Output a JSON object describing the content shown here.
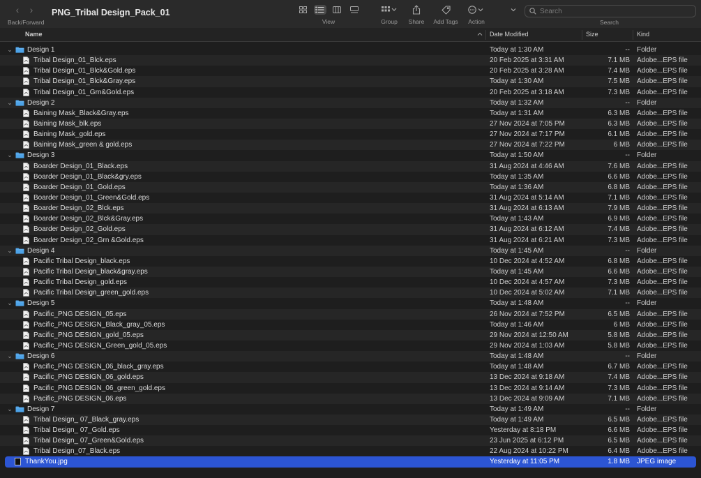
{
  "toolbar": {
    "title": "PNG_Tribal Design_Pack_01",
    "back_forward_label": "Back/Forward",
    "view_label": "View",
    "group_label": "Group",
    "share_label": "Share",
    "add_tags_label": "Add Tags",
    "action_label": "Action",
    "search_placeholder": "Search",
    "search_label": "Search"
  },
  "columns": {
    "name": "Name",
    "date": "Date Modified",
    "size": "Size",
    "kind": "Kind"
  },
  "rows": [
    {
      "type": "folder",
      "name": "Design 1",
      "date": "Today at 1:30 AM",
      "size": "--",
      "kind": "Folder"
    },
    {
      "type": "file",
      "name": "Tribal Design_01_Blck.eps",
      "date": "20 Feb 2025 at 3:31 AM",
      "size": "7.1 MB",
      "kind": "Adobe...EPS file"
    },
    {
      "type": "file",
      "name": "Tribal Design_01_Blck&Gold.eps",
      "date": "20 Feb 2025 at 3:28 AM",
      "size": "7.4 MB",
      "kind": "Adobe...EPS file"
    },
    {
      "type": "file",
      "name": "Tribal Design_01_Blck&Gray.eps",
      "date": "Today at 1:30 AM",
      "size": "7.5 MB",
      "kind": "Adobe...EPS file"
    },
    {
      "type": "file",
      "name": "Tribal Design_01_Grn&Gold.eps",
      "date": "20 Feb 2025 at 3:18 AM",
      "size": "7.3 MB",
      "kind": "Adobe...EPS file"
    },
    {
      "type": "folder",
      "name": "Design 2",
      "date": "Today at 1:32 AM",
      "size": "--",
      "kind": "Folder"
    },
    {
      "type": "file",
      "name": "Baining Mask_Black&Gray.eps",
      "date": "Today at 1:31 AM",
      "size": "6.3 MB",
      "kind": "Adobe...EPS file"
    },
    {
      "type": "file",
      "name": "Baining Mask_blk.eps",
      "date": "27 Nov 2024 at 7:05 PM",
      "size": "6.3 MB",
      "kind": "Adobe...EPS file"
    },
    {
      "type": "file",
      "name": "Baining Mask_gold.eps",
      "date": "27 Nov 2024 at 7:17 PM",
      "size": "6.1 MB",
      "kind": "Adobe...EPS file"
    },
    {
      "type": "file",
      "name": "Baining Mask_green & gold.eps",
      "date": "27 Nov 2024 at 7:22 PM",
      "size": "6 MB",
      "kind": "Adobe...EPS file"
    },
    {
      "type": "folder",
      "name": "Design 3",
      "date": "Today at 1:50 AM",
      "size": "--",
      "kind": "Folder"
    },
    {
      "type": "file",
      "name": "Boarder Design_01_Black.eps",
      "date": "31 Aug 2024 at 4:46 AM",
      "size": "7.6 MB",
      "kind": "Adobe...EPS file"
    },
    {
      "type": "file",
      "name": "Boarder Design_01_Black&gry.eps",
      "date": "Today at 1:35 AM",
      "size": "6.6 MB",
      "kind": "Adobe...EPS file"
    },
    {
      "type": "file",
      "name": "Boarder Design_01_Gold.eps",
      "date": "Today at 1:36 AM",
      "size": "6.8 MB",
      "kind": "Adobe...EPS file"
    },
    {
      "type": "file",
      "name": "Boarder Design_01_Green&Gold.eps",
      "date": "31 Aug 2024 at 5:14 AM",
      "size": "7.1 MB",
      "kind": "Adobe...EPS file"
    },
    {
      "type": "file",
      "name": "Boarder Design_02_Blck.eps",
      "date": "31 Aug 2024 at 6:13 AM",
      "size": "7.9 MB",
      "kind": "Adobe...EPS file"
    },
    {
      "type": "file",
      "name": "Boarder Design_02_Blck&Gray.eps",
      "date": "Today at 1:43 AM",
      "size": "6.9 MB",
      "kind": "Adobe...EPS file"
    },
    {
      "type": "file",
      "name": "Boarder Design_02_Gold.eps",
      "date": "31 Aug 2024 at 6:12 AM",
      "size": "7.4 MB",
      "kind": "Adobe...EPS file"
    },
    {
      "type": "file",
      "name": "Boarder Design_02_Grn &Gold.eps",
      "date": "31 Aug 2024 at 6:21 AM",
      "size": "7.3 MB",
      "kind": "Adobe...EPS file"
    },
    {
      "type": "folder",
      "name": "Design 4",
      "date": "Today at 1:45 AM",
      "size": "--",
      "kind": "Folder"
    },
    {
      "type": "file",
      "name": "Pacific Tribal Design_black.eps",
      "date": "10 Dec 2024 at 4:52 AM",
      "size": "6.8 MB",
      "kind": "Adobe...EPS file"
    },
    {
      "type": "file",
      "name": "Pacific Tribal Design_black&gray.eps",
      "date": "Today at 1:45 AM",
      "size": "6.6 MB",
      "kind": "Adobe...EPS file"
    },
    {
      "type": "file",
      "name": "Pacific Tribal Design_gold.eps",
      "date": "10 Dec 2024 at 4:57 AM",
      "size": "7.3 MB",
      "kind": "Adobe...EPS file"
    },
    {
      "type": "file",
      "name": "Pacific Tribal Design_green_gold.eps",
      "date": "10 Dec 2024 at 5:02 AM",
      "size": "7.1 MB",
      "kind": "Adobe...EPS file"
    },
    {
      "type": "folder",
      "name": "Design 5",
      "date": "Today at 1:48 AM",
      "size": "--",
      "kind": "Folder"
    },
    {
      "type": "file",
      "name": "Pacific_PNG DESIGN_05.eps",
      "date": "26 Nov 2024 at 7:52 PM",
      "size": "6.5 MB",
      "kind": "Adobe...EPS file"
    },
    {
      "type": "file",
      "name": "Pacific_PNG DESIGN_Black_gray_05.eps",
      "date": "Today at 1:46 AM",
      "size": "6 MB",
      "kind": "Adobe...EPS file"
    },
    {
      "type": "file",
      "name": "Pacific_PNG DESIGN_gold_05.eps",
      "date": "29 Nov 2024 at 12:50 AM",
      "size": "5.8 MB",
      "kind": "Adobe...EPS file"
    },
    {
      "type": "file",
      "name": "Pacific_PNG DESIGN_Green_gold_05.eps",
      "date": "29 Nov 2024 at 1:03 AM",
      "size": "5.8 MB",
      "kind": "Adobe...EPS file"
    },
    {
      "type": "folder",
      "name": "Design 6",
      "date": "Today at 1:48 AM",
      "size": "--",
      "kind": "Folder"
    },
    {
      "type": "file",
      "name": "Pacific_PNG DESIGN_06_black_gray.eps",
      "date": "Today at 1:48 AM",
      "size": "6.7 MB",
      "kind": "Adobe...EPS file"
    },
    {
      "type": "file",
      "name": "Pacific_PNG DESIGN_06_gold.eps",
      "date": "13 Dec 2024 at 9:18 AM",
      "size": "7.4 MB",
      "kind": "Adobe...EPS file"
    },
    {
      "type": "file",
      "name": "Pacific_PNG DESIGN_06_green_gold.eps",
      "date": "13 Dec 2024 at 9:14 AM",
      "size": "7.3 MB",
      "kind": "Adobe...EPS file"
    },
    {
      "type": "file",
      "name": "Pacific_PNG DESIGN_06.eps",
      "date": "13 Dec 2024 at 9:09 AM",
      "size": "7.1 MB",
      "kind": "Adobe...EPS file"
    },
    {
      "type": "folder",
      "name": "Design 7",
      "date": "Today at 1:49 AM",
      "size": "--",
      "kind": "Folder"
    },
    {
      "type": "file",
      "name": "Tribal Design_ 07_Black_gray.eps",
      "date": "Today at 1:49 AM",
      "size": "6.5 MB",
      "kind": "Adobe...EPS file"
    },
    {
      "type": "file",
      "name": "Tribal Design_ 07_Gold.eps",
      "date": "Yesterday at 8:18 PM",
      "size": "6.6 MB",
      "kind": "Adobe...EPS file"
    },
    {
      "type": "file",
      "name": "Tribal Design_ 07_Green&Gold.eps",
      "date": "23 Jun 2025 at 6:12 PM",
      "size": "6.5 MB",
      "kind": "Adobe...EPS file"
    },
    {
      "type": "file",
      "name": "Tribal Design_07_Black.eps",
      "date": "22 Aug 2024 at 10:22 PM",
      "size": "6.4 MB",
      "kind": "Adobe...EPS file"
    },
    {
      "type": "image",
      "name": "ThankYou.jpg",
      "date": "Yesterday at 11:05 PM",
      "size": "1.8 MB",
      "kind": "JPEG image",
      "selected": true
    }
  ],
  "colors": {
    "selection": "#2c55d3",
    "folder": "#4da3e8",
    "background": "#1e1e1e"
  }
}
